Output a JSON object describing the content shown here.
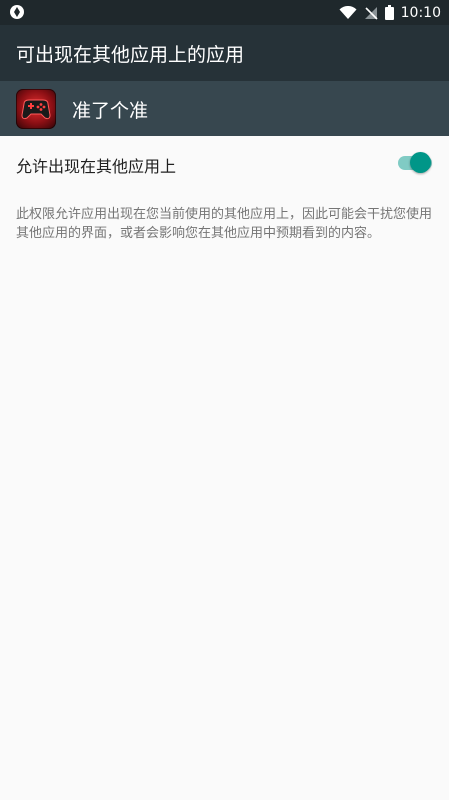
{
  "status_bar": {
    "left_icon": "circle-logo-icon",
    "icons": [
      "wifi-icon",
      "no-sim-icon",
      "battery-icon"
    ],
    "time": "10:10"
  },
  "toolbar": {
    "title": "可出现在其他应用上的应用"
  },
  "app": {
    "icon": "gamepad-icon",
    "name": "准了个准"
  },
  "setting": {
    "label": "允许出现在其他应用上",
    "enabled": true,
    "accent_color": "#009688"
  },
  "description": "此权限允许应用出现在您当前使用的其他应用上，因此可能会干扰您使用其他应用的界面，或者会影响您在其他应用中预期看到的内容。"
}
